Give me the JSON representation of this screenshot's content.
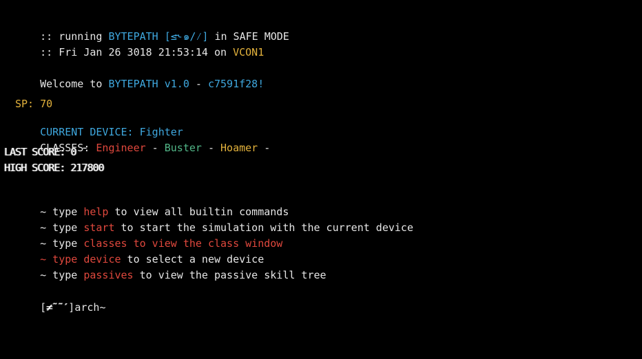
{
  "boot": {
    "prefix1": ":: running ",
    "game": "BYTEPATH",
    "glyphs": "[≤˞๑/⁄]",
    "mode": " in SAFE MODE",
    "prefix2": ":: Fri Jan 26 3018 21:53:14 on ",
    "console": "VCON1"
  },
  "welcome": {
    "prefix": "Welcome to ",
    "game": "BYTEPATH",
    "version": "v1.0",
    "dash": " - ",
    "hash": "c7591f28!"
  },
  "status": {
    "sp": "SP: 70",
    "device_label": "CURRENT DEVICE: ",
    "device_value": "Fighter",
    "classes_label": "CLASSES: ",
    "classes": [
      "Engineer",
      "Buster",
      "Hoamer"
    ],
    "sep": " - ",
    "trailing": " -",
    "last_score": "LAST SCORE: 0 ¯",
    "high_score": "HIGH SCORE: 217800"
  },
  "help": [
    {
      "prefix": "~ type ",
      "cmd": "help",
      "suffix": " to view all builtin commands"
    },
    {
      "prefix": "~ type ",
      "cmd": "start",
      "suffix": " to start the simulation with the current device"
    },
    {
      "prefix": "~ type ",
      "cmd": "classes",
      "suffix": " to view the class window"
    },
    {
      "prefix": "~ type ",
      "cmd": "device",
      "suffix": " to select a new device"
    },
    {
      "prefix": "~ type ",
      "cmd": "passives",
      "suffix": " to view the passive skill tree"
    }
  ],
  "prompt": {
    "open": "[",
    "user": "≠˜˜′",
    "close": "]",
    "cwd": "arch",
    "cursor": "~"
  },
  "colors": {
    "background": "#000000",
    "cyan": "#3fa8df",
    "yellow": "#e3b23c",
    "red": "#e0483d",
    "green": "#52b788",
    "white": "#e6e6e6"
  }
}
